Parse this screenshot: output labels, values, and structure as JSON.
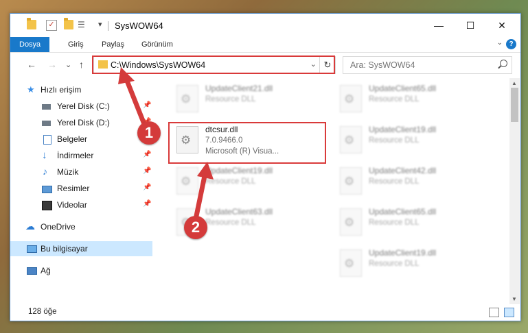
{
  "window": {
    "title": "SysWOW64",
    "qat_dropdown": "▾",
    "controls": {
      "minimize": "—",
      "maximize": "☐",
      "close": "✕"
    }
  },
  "ribbon": {
    "tabs": [
      "Dosya",
      "Giriş",
      "Paylaş",
      "Görünüm"
    ],
    "expand_label": "⌄",
    "help_label": "?"
  },
  "nav": {
    "back": "←",
    "forward": "→",
    "recent": "⌄",
    "up": "↑",
    "address": "C:\\Windows\\SysWOW64",
    "refresh": "↻",
    "search_placeholder": "Ara: SysWOW64"
  },
  "sidebar": {
    "items": [
      {
        "label": "Hızlı erişim",
        "icon": "star-icon"
      },
      {
        "label": "Yerel Disk (C:)",
        "icon": "drive-icon",
        "pinned": true
      },
      {
        "label": "Yerel Disk (D:)",
        "icon": "drive-icon",
        "pinned": true
      },
      {
        "label": "Belgeler",
        "icon": "document-icon",
        "pinned": true
      },
      {
        "label": "İndirmeler",
        "icon": "download-icon",
        "pinned": true
      },
      {
        "label": "Müzik",
        "icon": "music-icon",
        "pinned": true
      },
      {
        "label": "Resimler",
        "icon": "pictures-icon",
        "pinned": true
      },
      {
        "label": "Videolar",
        "icon": "video-icon",
        "pinned": true
      },
      {
        "label": "OneDrive",
        "icon": "cloud-icon"
      },
      {
        "label": "Bu bilgisayar",
        "icon": "computer-icon",
        "selected": true
      },
      {
        "label": "Ağ",
        "icon": "network-icon"
      }
    ],
    "pin_glyph": "📌"
  },
  "files": {
    "left": [
      {
        "name": "UpdateClient21.dll",
        "type": "Resource DLL"
      },
      {
        "name": "dtcsur.dll",
        "version": "7.0.9466.0",
        "company": "Microsoft (R) Visua..."
      },
      {
        "name": "UpdateClient19.dll",
        "type": "Resource DLL"
      },
      {
        "name": "UpdateClient63.dll",
        "type": "Resource DLL"
      }
    ],
    "right": [
      {
        "name": "UpdateClient65.dll",
        "type": "Resource DLL"
      },
      {
        "name": "UpdateClient19.dll",
        "type": "Resource DLL"
      },
      {
        "name": "UpdateClient42.dll",
        "type": "Resource DLL"
      },
      {
        "name": "UpdateClient65.dll",
        "type": "Resource DLL"
      },
      {
        "name": "UpdateClient19.dll",
        "type": "Resource DLL"
      }
    ]
  },
  "status": {
    "count": "128 öğe"
  },
  "annotations": {
    "badge1": "1",
    "badge2": "2",
    "color": "#d43b3b"
  }
}
